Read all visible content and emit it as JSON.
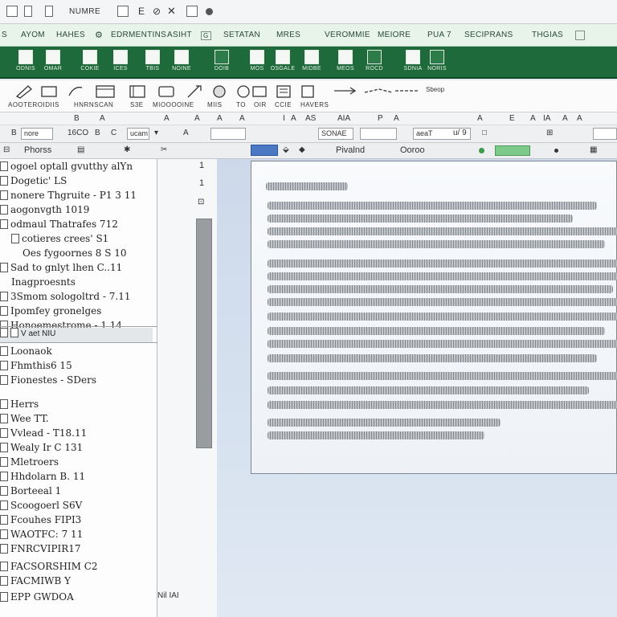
{
  "titlebar": {
    "app_title": "NUMRE"
  },
  "menu": {
    "tabs": [
      "AYOM",
      "HAHES",
      "EDRMENTINS",
      "ASIHT",
      "SETATAN",
      "MRES",
      "VEROMMIE",
      "MEIORE",
      "PUA 7",
      "SECIPRANS",
      "THGIAS"
    ],
    "tab_prefix": "S"
  },
  "ribbon": {
    "items": [
      "ODNIS",
      "OMAR",
      "COKIE",
      "ICES",
      "TBIS",
      "NOINE",
      "DOIB",
      "MOS",
      "OSGALE",
      "MIDBE",
      "MEOS",
      "ROCD",
      "SDNIA",
      "NORIS"
    ]
  },
  "tools": {
    "labels": [
      "AOOTEROIDIIS",
      "HNRNSCAN",
      "S3E",
      "MIOOOOINE",
      "MIIS",
      "TO",
      "OIR",
      "CCIE",
      "HAVERS"
    ],
    "side_label": "Sbeop"
  },
  "letter_row": {
    "letters": [
      "B",
      "A",
      "A",
      "A",
      "A",
      "A",
      "I",
      "A",
      "AS",
      "AIA",
      "P",
      "A",
      "A",
      "E",
      "A",
      "IA",
      "A",
      "A"
    ]
  },
  "format_row": {
    "font_name": "nore",
    "size_label": "16CO",
    "field_a": "ucam",
    "field_b": "SONAE",
    "field_c": "aeaT",
    "extra": "u/ 9"
  },
  "panel_header": {
    "left_title": "Phorss",
    "doc_label": "Pivalnd",
    "view_label": "Ooroo"
  },
  "left_panel": {
    "top_items": [
      "ogoel optall gvutthy alYn",
      "Dogetic' LS",
      "nonere Thgruite - P1 3 11",
      "aogonvgth 1019",
      "odmaul Thatrafes 712",
      "cotieres crees' S1",
      "Oes fygoornes 8 S 10",
      "Sad to gnlyt lhen C..11",
      "Inagproesnts",
      "3Smom sologoltrd - 7.11",
      "Ipomfey gronelges",
      "Honoemestrome - 1 14"
    ],
    "subbar": "V  aet  NIU",
    "bottom_items": [
      "Loonaok",
      "Fhmthis6 15",
      "Fionestes - SDers",
      "Herrs",
      "Wee TT.",
      "Vvlead - T18.11",
      "Wealy Ir       C 131",
      "Mletroers",
      "Hhdolarn B. 11",
      "Borteeal 1",
      "Scoogoerl S6V",
      "Fcouhes FIPI3",
      "WAOTFC: 7 11",
      "FNRCVIPIR17",
      "FACSORSHIM C2",
      "FACMIWB Y",
      "EPP GWDOA"
    ]
  },
  "scroll_numbers": [
    "1",
    "1"
  ],
  "status": {
    "bottom_text": "Nil  IAI"
  }
}
